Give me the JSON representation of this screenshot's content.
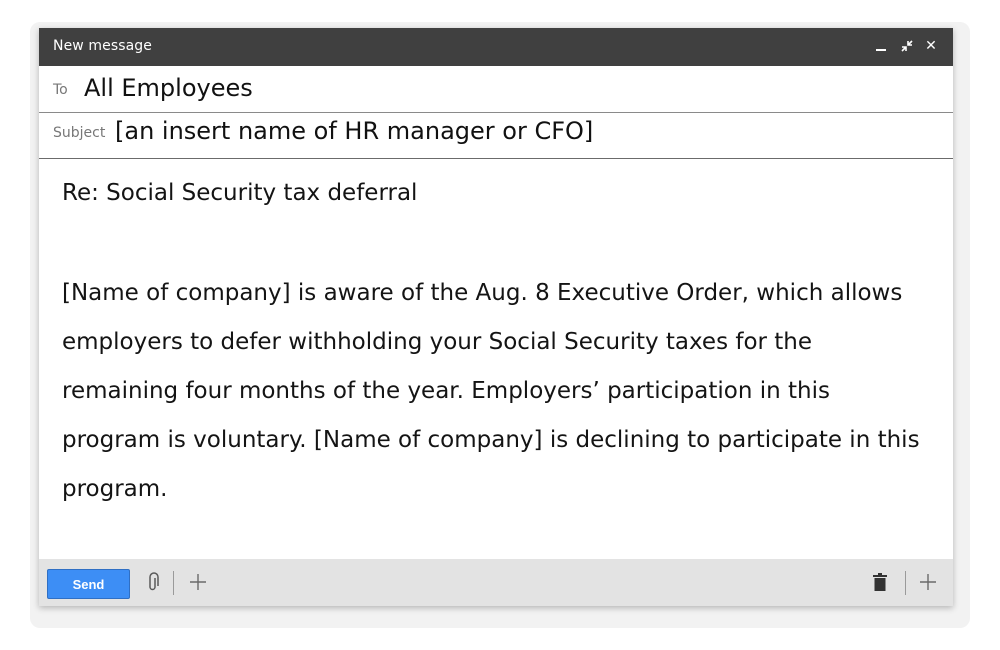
{
  "window": {
    "title": "New message",
    "controls": {
      "minimize_icon": "minimize-icon",
      "shrink_icon": "shrink-icon",
      "close_icon": "close-icon",
      "close_glyph": "✕"
    }
  },
  "compose": {
    "to_label": "To",
    "to_value": "All Employees",
    "subject_label": "Subject",
    "subject_value": "[an insert name of HR manager or CFO]"
  },
  "body": {
    "subject_line": "Re: Social Security tax deferral",
    "paragraph": "[Name of company] is aware of the Aug. 8 Executive Order, which allows employers to defer withholding your Social Security taxes for the remaining four months of the year. Employers’ participation in this program is voluntary. [Name of company] is declining to participate in this program."
  },
  "footer": {
    "send_label": "Send",
    "plus_glyph": "+",
    "icons": [
      "paperclip-icon",
      "plus-icon",
      "trash-icon",
      "plus-icon"
    ]
  },
  "colors": {
    "titlebar": "#404040",
    "send_button": "#3d8ef5",
    "footer_bg": "#e3e3e3"
  }
}
